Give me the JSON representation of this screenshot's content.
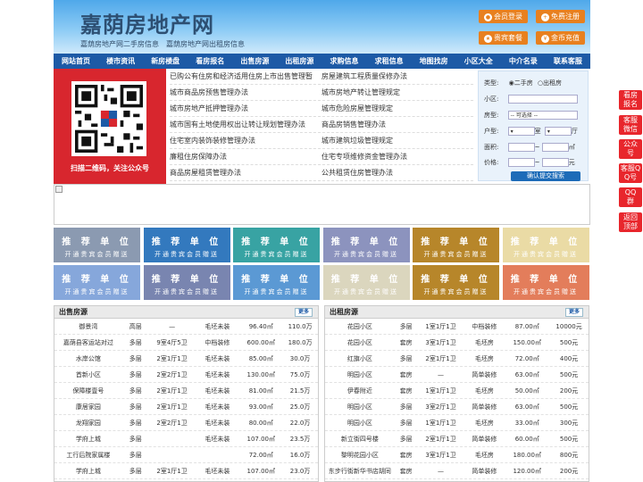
{
  "header": {
    "title": "嘉荫房地产网",
    "subtitle_left": "嘉荫房地产网二手房信息",
    "subtitle_right": "嘉荫房地产网出租房信息",
    "buttons": [
      "会员登录",
      "免费注册",
      "贵宾套餐",
      "金币充值"
    ]
  },
  "nav": [
    "网站首页",
    "楼市资讯",
    "新房楼盘",
    "看房报名",
    "出售房源",
    "出租房源",
    "求购信息",
    "求租信息",
    "地图找房",
    "小区大全",
    "中介名录",
    "联系客服"
  ],
  "qr": {
    "caption": "扫描二维码，关注公众号"
  },
  "links": [
    [
      "已购公有住房和经济适用住房上市出售管理暂",
      "房屋建筑工程质量保修办法"
    ],
    [
      "城市商品房预售管理办法",
      "城市房地产转让管理规定"
    ],
    [
      "城市房地产抵押管理办法",
      "城市危险房屋管理规定"
    ],
    [
      "城市国有土地使用权出让转让规划管理办法",
      "商品房销售管理办法"
    ],
    [
      "住宅室内装饰装修管理办法",
      "城市建筑垃圾管理规定"
    ],
    [
      "廉租住房保障办法",
      "住宅专项维修资金管理办法"
    ],
    [
      "商品房屋租赁管理办法",
      "公共租赁住房管理办法"
    ]
  ],
  "search": {
    "type_label": "类型:",
    "type_sale": "二手房",
    "type_rent": "出租房",
    "community_label": "小区:",
    "house_type_label": "房型:",
    "house_type_value": "-- 可选择 --",
    "layout_label": "户型:",
    "rooms_unit": "室",
    "halls_unit": "厅",
    "area_label": "面积:",
    "area_unit": "㎡",
    "price_label": "价格:",
    "price_unit": "元",
    "tilde": "~",
    "submit": "确认提交搜索"
  },
  "ads": {
    "title": "推 荐 单 位",
    "subtitle": "开通贵宾会员赠送",
    "colors": [
      "#7f90a9",
      "#1d6bb8",
      "#239a9a",
      "#8088b8",
      "#b07a14",
      "#e8d89c",
      "#7a9ed8",
      "#6b78a8",
      "#4a8fd0",
      "#d8d2b8",
      "#b07a14",
      "#e0704a"
    ]
  },
  "sale": {
    "title": "出售房源",
    "more": "更多",
    "rows": [
      [
        "御景湾",
        "高层",
        "—",
        "毛坯未装",
        "96.40㎡",
        "110.0万"
      ],
      [
        "嘉荫县客运站对过",
        "多层",
        "9室4厅5卫",
        "中档装修",
        "600.00㎡",
        "180.0万"
      ],
      [
        "水岸公馆",
        "多层",
        "2室1厅1卫",
        "毛坯未装",
        "85.00㎡",
        "30.0万"
      ],
      [
        "首新小区",
        "多层",
        "2室2厅1卫",
        "毛坯未装",
        "130.00㎡",
        "75.0万"
      ],
      [
        "保障楼壹号",
        "多层",
        "2室1厅1卫",
        "毛坯未装",
        "81.00㎡",
        "21.5万"
      ],
      [
        "康居家园",
        "多层",
        "2室1厅1卫",
        "毛坯未装",
        "93.00㎡",
        "25.0万"
      ],
      [
        "龙翔家园",
        "多层",
        "2室2厅1卫",
        "毛坯未装",
        "80.00㎡",
        "22.0万"
      ],
      [
        "学府上城",
        "多层",
        "",
        "毛坯未装",
        "107.00㎡",
        "23.5万"
      ],
      [
        "工行后院家属楼",
        "多层",
        "",
        "",
        "72.00㎡",
        "16.0万"
      ],
      [
        "学府上城",
        "多层",
        "2室1厅1卫",
        "毛坯未装",
        "107.00㎡",
        "23.0万"
      ]
    ]
  },
  "rent": {
    "title": "出租房源",
    "more": "更多",
    "rows": [
      [
        "花园小区",
        "多层",
        "1室1厅1卫",
        "中档装修",
        "87.00㎡",
        "10000元"
      ],
      [
        "花园小区",
        "套房",
        "3室1厅1卫",
        "毛坯房",
        "150.00㎡",
        "500元"
      ],
      [
        "红旗小区",
        "多层",
        "2室1厅1卫",
        "毛坯房",
        "72.00㎡",
        "400元"
      ],
      [
        "明园小区",
        "套房",
        "—",
        "简单装修",
        "63.00㎡",
        "500元"
      ],
      [
        "伊春附近",
        "套房",
        "1室1厅1卫",
        "毛坯房",
        "50.00㎡",
        "200元"
      ],
      [
        "明园小区",
        "多层",
        "3室2厅1卫",
        "简单装修",
        "63.00㎡",
        "500元"
      ],
      [
        "明园小区",
        "多层",
        "1室1厅1卫",
        "毛坯房",
        "33.00㎡",
        "300元"
      ],
      [
        "新立街四号楼",
        "多层",
        "2室1厅1卫",
        "简单装修",
        "60.00㎡",
        "500元"
      ],
      [
        "黎明花园小区",
        "套房",
        "3室1厅1卫",
        "毛坯房",
        "180.00㎡",
        "800元"
      ],
      [
        "东步行街新华书店胡同",
        "套房",
        "—",
        "简单装修",
        "120.00㎡",
        "200元"
      ]
    ]
  },
  "side": [
    "看房报名",
    "客服微信",
    "公众号",
    "客服QQ号",
    "QQ群",
    "返回顶部"
  ]
}
